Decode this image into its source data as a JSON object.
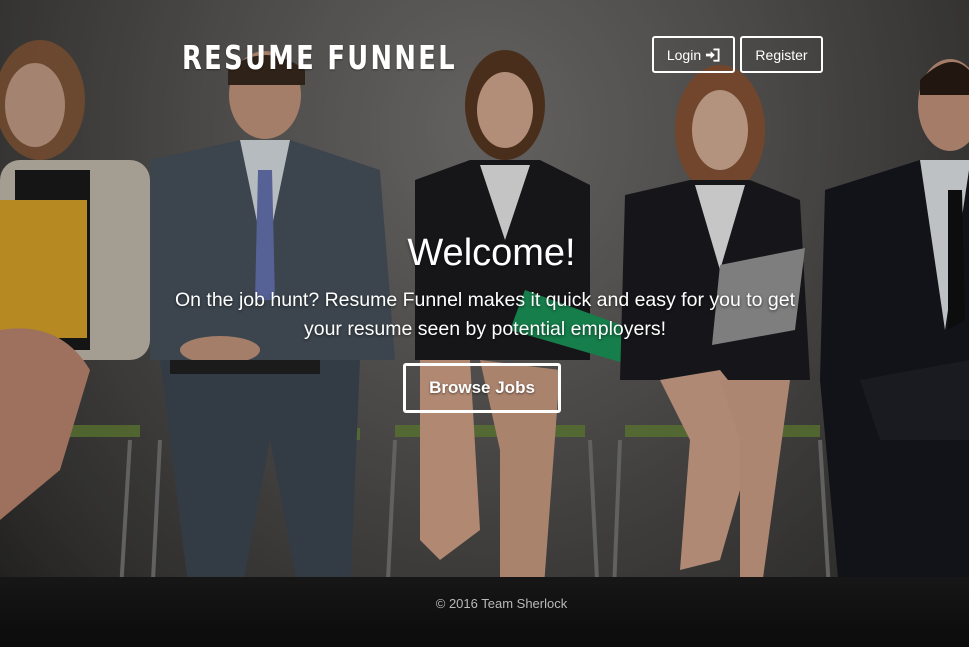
{
  "brand": {
    "name": "RESUME FUNNEL"
  },
  "nav": {
    "login_label": "Login",
    "login_icon": "sign-in-icon",
    "register_label": "Register"
  },
  "hero": {
    "title": "Welcome!",
    "subtitle": "On the job hunt? Resume Funnel makes it quick and easy for you to get your resume seen by potential employers!",
    "cta_label": "Browse Jobs"
  },
  "footer": {
    "copyright": "© 2016 Team Sherlock"
  },
  "colors": {
    "text": "#ffffff",
    "footer_text": "#b9b9b9"
  }
}
